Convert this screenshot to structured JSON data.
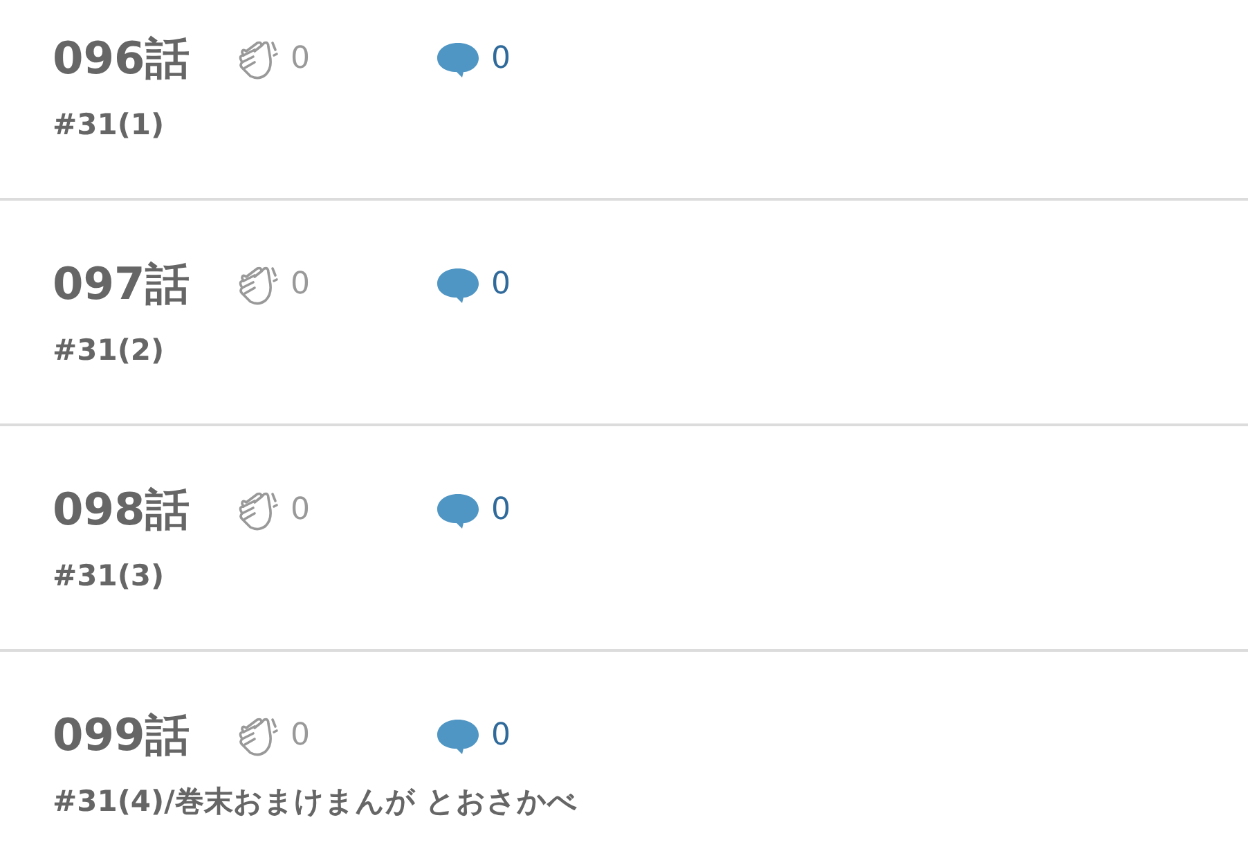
{
  "episodes": [
    {
      "title": "096話",
      "claps": "0",
      "comments": "0",
      "subtitle": "#31(1)"
    },
    {
      "title": "097話",
      "claps": "0",
      "comments": "0",
      "subtitle": "#31(2)"
    },
    {
      "title": "098話",
      "claps": "0",
      "comments": "0",
      "subtitle": "#31(3)"
    },
    {
      "title": "099話",
      "claps": "0",
      "comments": "0",
      "subtitle": "#31(4)/巻末おまけまんが とおさかべ"
    }
  ]
}
